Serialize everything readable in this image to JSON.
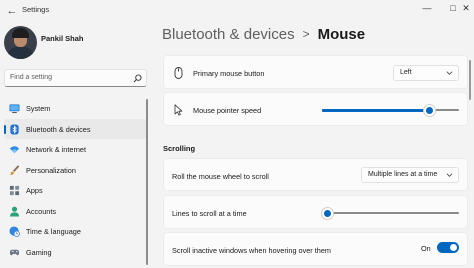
{
  "window": {
    "title": "Settings",
    "back_icon": "arrow-left-icon",
    "controls": [
      "minimize-icon",
      "maximize-icon",
      "close-icon"
    ]
  },
  "profile": {
    "name": "Pankil Shah"
  },
  "search": {
    "placeholder": "Find a setting",
    "icon": "search-icon"
  },
  "sidebar": {
    "items": [
      {
        "label": "System",
        "icon": "monitor-icon",
        "active": false
      },
      {
        "label": "Bluetooth & devices",
        "icon": "bluetooth-icon",
        "active": true
      },
      {
        "label": "Network & internet",
        "icon": "wifi-icon",
        "active": false
      },
      {
        "label": "Personalization",
        "icon": "brush-icon",
        "active": false
      },
      {
        "label": "Apps",
        "icon": "apps-icon",
        "active": false
      },
      {
        "label": "Accounts",
        "icon": "person-icon",
        "active": false
      },
      {
        "label": "Time & language",
        "icon": "globe-clock-icon",
        "active": false
      },
      {
        "label": "Gaming",
        "icon": "gamepad-icon",
        "active": false
      }
    ]
  },
  "breadcrumb": {
    "parent": "Bluetooth & devices",
    "separator": ">",
    "current": "Mouse"
  },
  "settings": {
    "primary_button": {
      "label": "Primary mouse button",
      "value": "Left",
      "icon": "mouse-icon"
    },
    "pointer_speed": {
      "label": "Mouse pointer speed",
      "value_fraction": 0.78,
      "icon": "pointer-icon"
    },
    "scrolling_title": "Scrolling",
    "roll_wheel": {
      "label": "Roll the mouse wheel to scroll",
      "value": "Multiple lines at a time"
    },
    "lines_to_scroll": {
      "label": "Lines to scroll at a time",
      "value_fraction": 0.03
    },
    "inactive_scroll": {
      "label": "Scroll inactive windows when hovering over them",
      "state_label": "On",
      "on": true
    }
  },
  "colors": {
    "accent": "#0067c0",
    "background": "#f3f3f3",
    "card": "#fbfbfb"
  }
}
